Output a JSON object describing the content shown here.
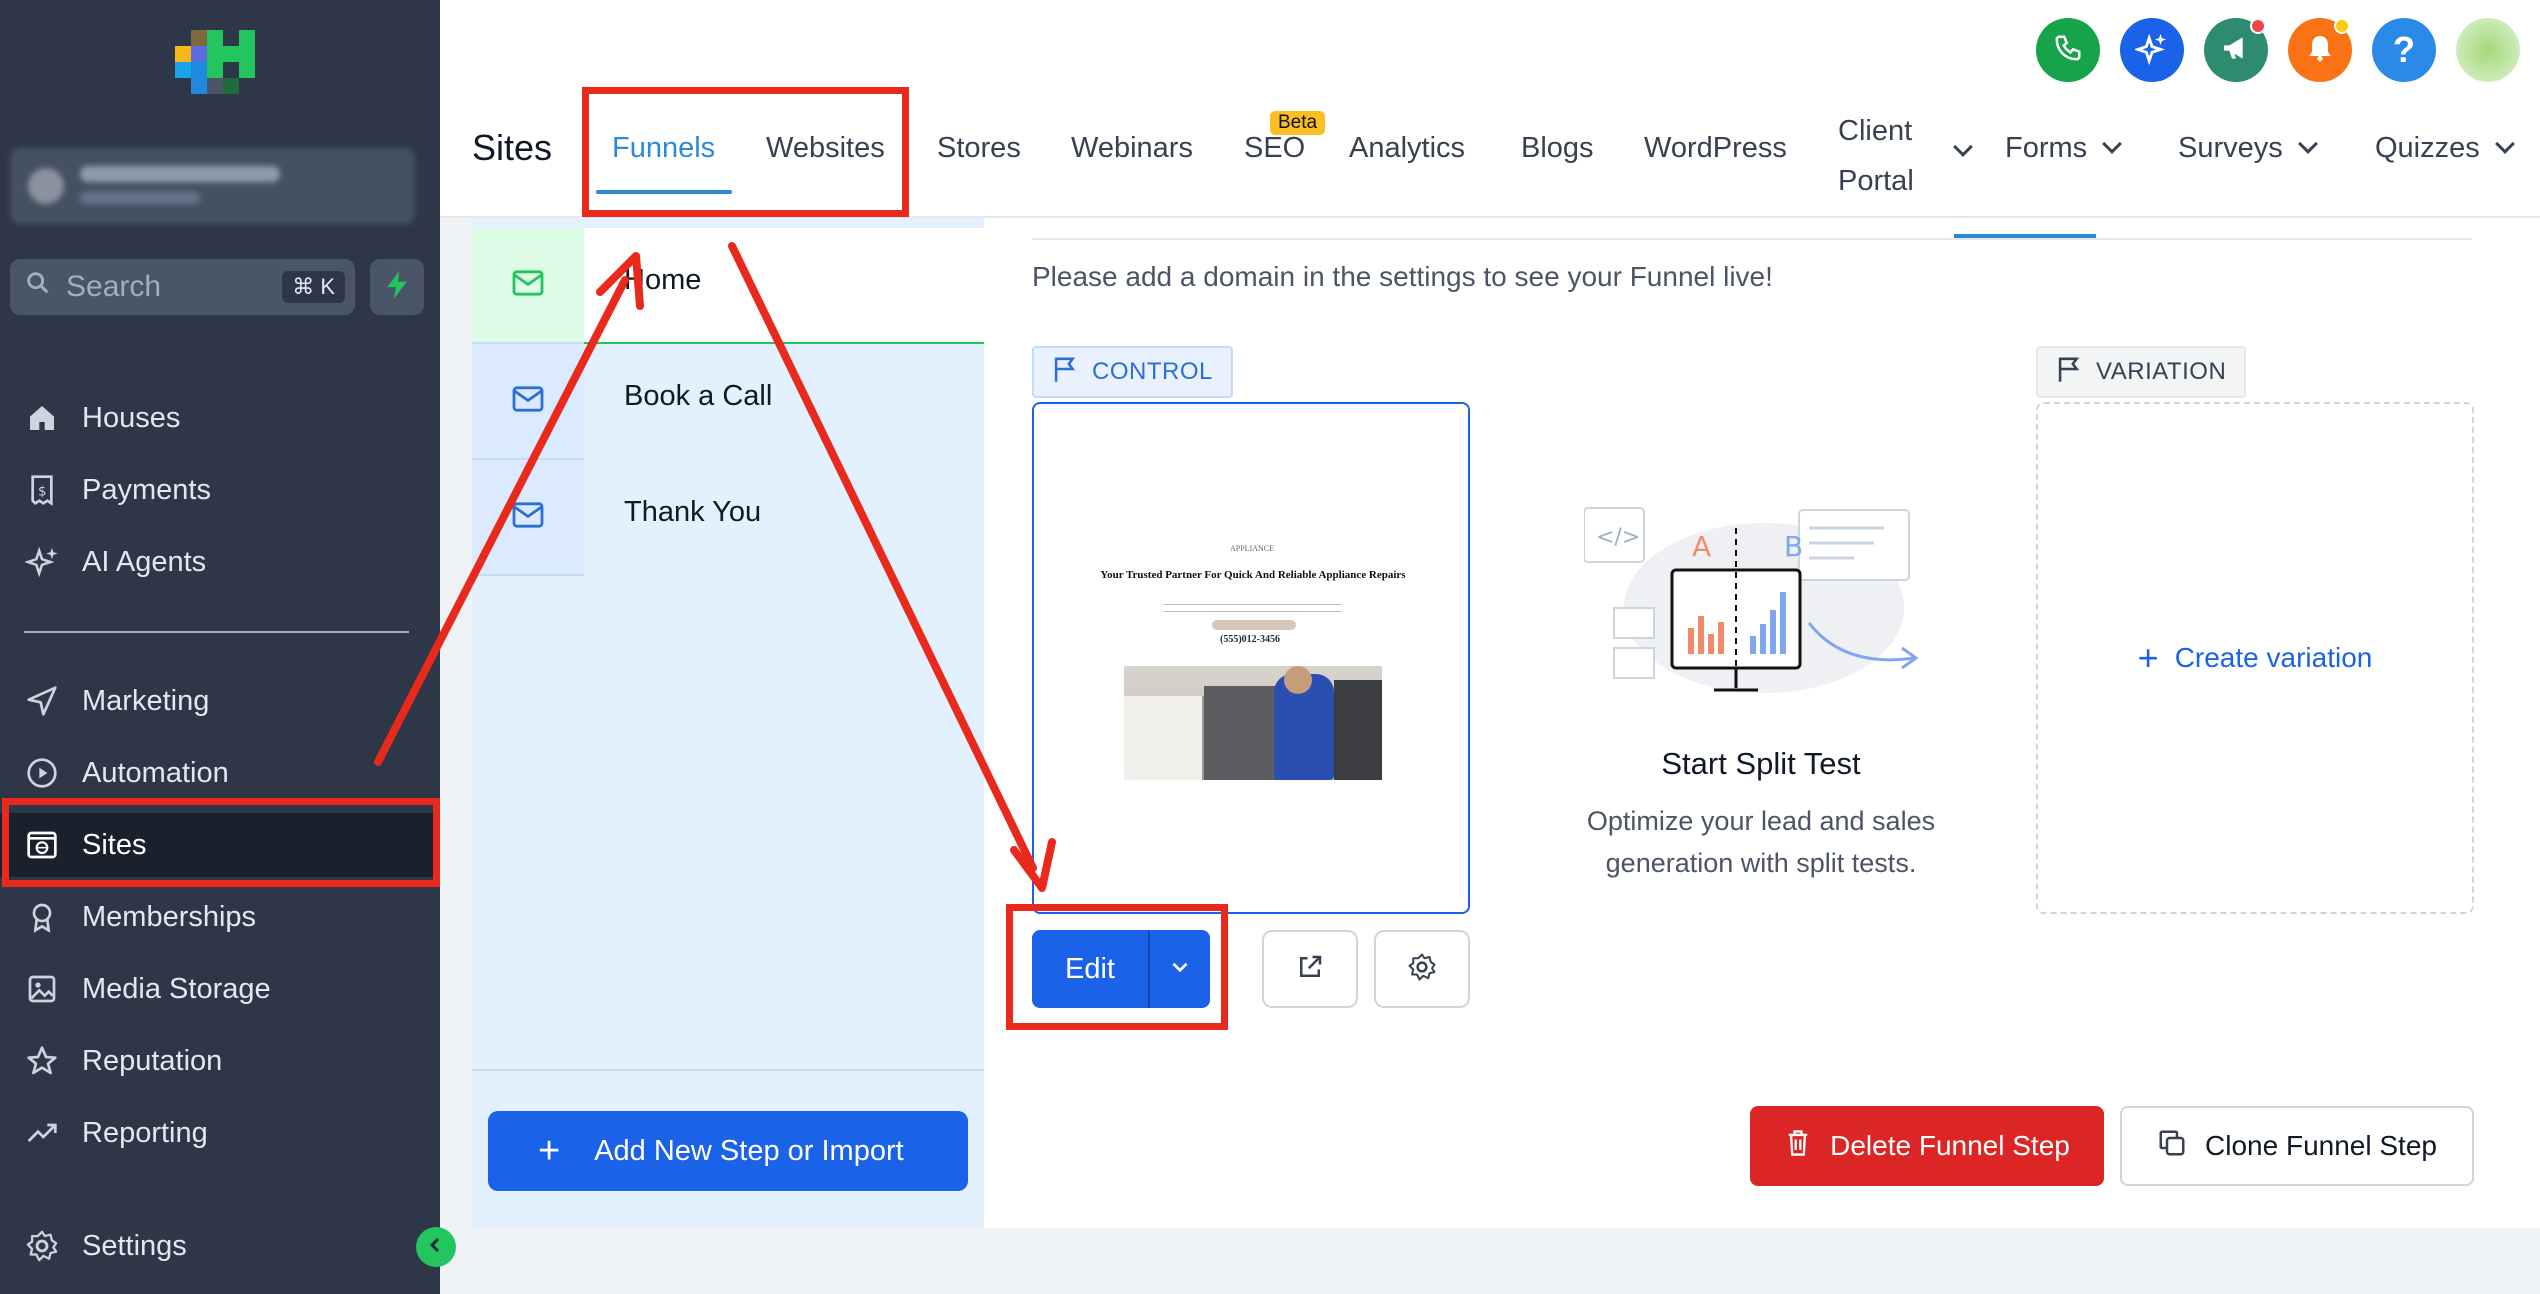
{
  "sidebar": {
    "search": {
      "placeholder": "Search",
      "shortcut": "⌘ K"
    },
    "items": [
      {
        "label": "Houses",
        "icon": "home-icon"
      },
      {
        "label": "Payments",
        "icon": "receipt-icon"
      },
      {
        "label": "AI Agents",
        "icon": "sparkle-icon"
      },
      {
        "label": "Marketing",
        "icon": "send-icon"
      },
      {
        "label": "Automation",
        "icon": "play-circle-icon"
      },
      {
        "label": "Sites",
        "icon": "globe-window-icon",
        "active": true
      },
      {
        "label": "Memberships",
        "icon": "award-icon"
      },
      {
        "label": "Media Storage",
        "icon": "image-icon"
      },
      {
        "label": "Reputation",
        "icon": "star-icon"
      },
      {
        "label": "Reporting",
        "icon": "trend-icon"
      }
    ],
    "settings_label": "Settings"
  },
  "header": {
    "page_title": "Sites",
    "tabs": [
      {
        "label": "Funnels",
        "active": true
      },
      {
        "label": "Websites"
      },
      {
        "label": "Stores"
      },
      {
        "label": "Webinars"
      },
      {
        "label": "SEO",
        "badge": "Beta"
      },
      {
        "label": "Analytics"
      },
      {
        "label": "Blogs"
      },
      {
        "label": "WordPress"
      },
      {
        "label": "Client Portal",
        "line1": "Client",
        "line2": "Portal",
        "dropdown": true
      },
      {
        "label": "Forms",
        "dropdown": true
      },
      {
        "label": "Surveys",
        "dropdown": true
      },
      {
        "label": "Quizzes",
        "dropdown": true
      }
    ],
    "icons": [
      "phone-icon",
      "sparkle-icon",
      "megaphone-icon",
      "bell-icon",
      "help-icon",
      "avatar"
    ]
  },
  "steps": {
    "items": [
      {
        "label": "Home",
        "active": true
      },
      {
        "label": "Book a Call"
      },
      {
        "label": "Thank You"
      }
    ],
    "add_button": "Add New Step or Import"
  },
  "main": {
    "notice": "Please add a domain in the settings to see your Funnel live!",
    "control_label": "CONTROL",
    "variation_label": "VARIATION",
    "preview": {
      "logo_text": "APPLIANCE",
      "headline": "Your Trusted Partner For Quick And Reliable Appliance Repairs",
      "phone": "(555)012-3456"
    },
    "edit_label": "Edit",
    "split_test": {
      "title": "Start Split Test",
      "description": "Optimize your lead and sales generation with split tests.",
      "label_a": "A",
      "label_b": "B"
    },
    "create_variation": "Create variation",
    "delete_label": "Delete Funnel Step",
    "clone_label": "Clone Funnel Step"
  },
  "colors": {
    "primary": "#1a62e8",
    "tab_active": "#2b8ad8",
    "sidebar_bg": "#2d3748",
    "danger": "#dc2626",
    "annotation": "#e8291c"
  }
}
